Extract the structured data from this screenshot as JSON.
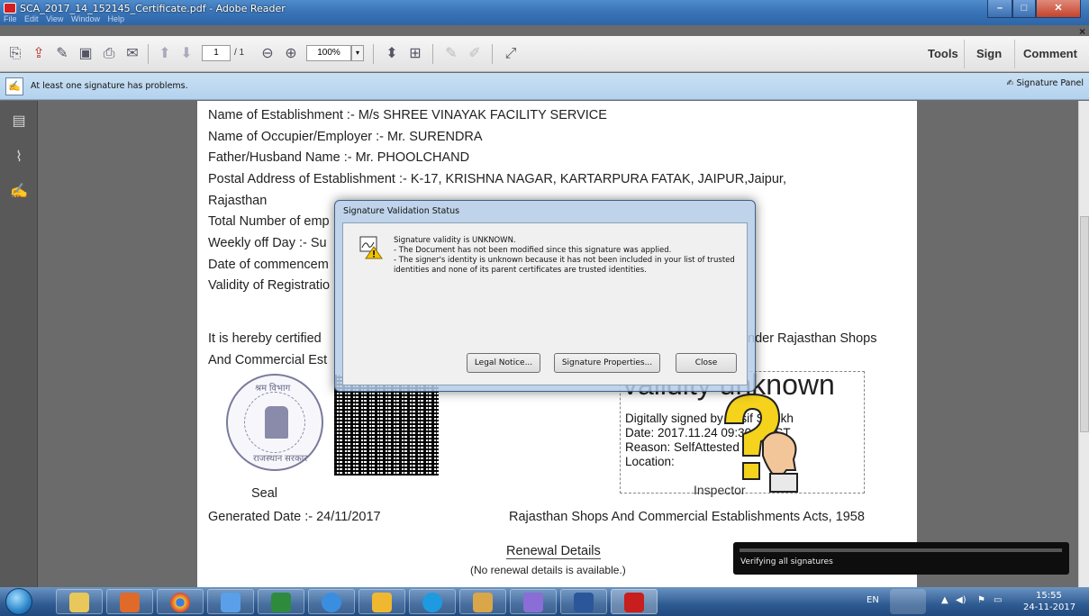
{
  "window": {
    "title": "SCA_2017_14_152145_Certificate.pdf - Adobe Reader",
    "menu": [
      "File",
      "Edit",
      "View",
      "Window",
      "Help"
    ]
  },
  "toolbar": {
    "page_current": "1",
    "page_total": "/ 1",
    "zoom": "100%",
    "tools_label": "Tools",
    "sign_label": "Sign",
    "comment_label": "Comment"
  },
  "notification": {
    "message": "At least one signature has problems.",
    "panel_button": "Signature Panel"
  },
  "document": {
    "lines": [
      "Name of Establishment :-  M/s SHREE VINAYAK FACILITY SERVICE",
      "Name of Occupier/Employer :-  Mr. SURENDRA",
      "Father/Husband Name :-  Mr. PHOOLCHAND",
      "Postal Address of Establishment :-  K-17, KRISHNA NAGAR, KARTARPURA FATAK, JAIPUR,Jaipur,",
      "Rajasthan",
      "Total Number of emp",
      "Weekly off Day :-  Su",
      "Date of commencem",
      "Validity of Registratio"
    ],
    "certified_left": "It is hereby certified",
    "certified_right": "nder Rajasthan Shops",
    "commercial": "And Commercial Est",
    "seal_label": "Seal",
    "generated": "Generated Date :- 24/11/2017",
    "act": "Rajasthan Shops And Commercial Establishments Acts, 1958",
    "renewal_title": "Renewal Details",
    "renewal_note": "(No renewal details is available.)",
    "seal_text_top": "श्रम  विभाग",
    "seal_text_bottom": "राजस्थान सरकार"
  },
  "signature": {
    "big": "Validity unknown",
    "signed_by": "Digitally signed by Aasif Sheikh",
    "date": "Date: 2017.11.24 09:30:14 IST",
    "reason": "Reason: SelfAttested",
    "location": "Location:",
    "inspector": "Inspector"
  },
  "dialog": {
    "title": "Signature Validation Status",
    "line1": "Signature validity is UNKNOWN.",
    "line2": "- The Document has not been modified since this signature was applied.",
    "line3": "- The signer's identity is unknown because it has not been included in your list of trusted identities and none of its parent certificates are trusted identities.",
    "legal_button": "Legal Notice...",
    "properties_button": "Signature Properties...",
    "close_button": "Close"
  },
  "toast": {
    "text": "Verifying all signatures"
  },
  "taskbar": {
    "language": "EN",
    "time": "15:55",
    "date": "24-11-2017"
  }
}
